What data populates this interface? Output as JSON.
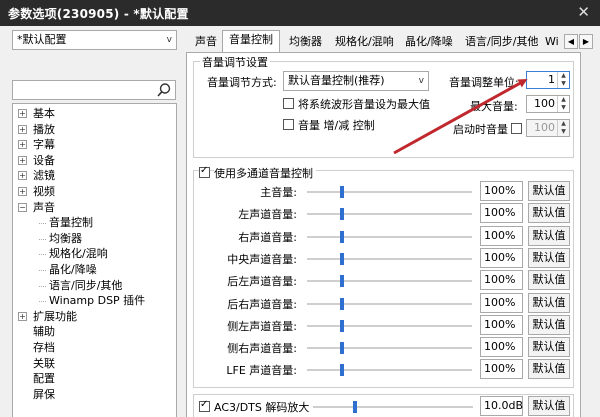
{
  "window": {
    "title": "参数选项(230905) - *默认配置",
    "close_glyph": "✕"
  },
  "profile_select": {
    "value": "*默认配置"
  },
  "search": {
    "value": ""
  },
  "tree": [
    {
      "label": "基本",
      "level": 0,
      "expand": "+"
    },
    {
      "label": "播放",
      "level": 0,
      "expand": "+"
    },
    {
      "label": "字幕",
      "level": 0,
      "expand": "+"
    },
    {
      "label": "设备",
      "level": 0,
      "expand": "+"
    },
    {
      "label": "滤镜",
      "level": 0,
      "expand": "+"
    },
    {
      "label": "视频",
      "level": 0,
      "expand": "+"
    },
    {
      "label": "声音",
      "level": 0,
      "expand": "−"
    },
    {
      "label": "音量控制",
      "level": 1
    },
    {
      "label": "均衡器",
      "level": 1
    },
    {
      "label": "规格化/混响",
      "level": 1
    },
    {
      "label": "晶化/降噪",
      "level": 1
    },
    {
      "label": "语言/同步/其他",
      "level": 1
    },
    {
      "label": "Winamp DSP 插件",
      "level": 1
    },
    {
      "label": "扩展功能",
      "level": 0,
      "expand": "+"
    },
    {
      "label": "辅助",
      "level": 0
    },
    {
      "label": "存档",
      "level": 0
    },
    {
      "label": "关联",
      "level": 0
    },
    {
      "label": "配置",
      "level": 0
    },
    {
      "label": "屏保",
      "level": 0
    }
  ],
  "tabs": [
    "声音",
    "音量控制",
    "均衡器",
    "规格化/混响",
    "晶化/降噪",
    "语言/同步/其他",
    "Wi"
  ],
  "tab_nav": {
    "prev": "◀",
    "next": "▶"
  },
  "volume_settings": {
    "group_title": "音量调节设置",
    "method_label": "音量调节方式:",
    "method_value": "默认音量控制(推荐)",
    "cb_max_wave": "将系统波形音量设为最大值",
    "cb_inc_dec": "音量 增/减 控制",
    "unit_label": "音量调整单位:",
    "unit_value": "1",
    "max_label": "最大音量:",
    "max_value": "100",
    "startup_label": "启动时音量",
    "startup_value": "100"
  },
  "multichannel": {
    "checkbox_label": "使用多通道音量控制",
    "default_label": "默认值",
    "channels": [
      {
        "label": "主音量:",
        "value": "100%",
        "level": 0.2
      },
      {
        "label": "左声道音量:",
        "value": "100%",
        "level": 0.2
      },
      {
        "label": "右声道音量:",
        "value": "100%",
        "level": 0.2
      },
      {
        "label": "中央声道音量:",
        "value": "100%",
        "level": 0.2
      },
      {
        "label": "后左声道音量:",
        "value": "100%",
        "level": 0.2
      },
      {
        "label": "后右声道音量:",
        "value": "100%",
        "level": 0.2
      },
      {
        "label": "侧左声道音量:",
        "value": "100%",
        "level": 0.2
      },
      {
        "label": "侧右声道音量:",
        "value": "100%",
        "level": 0.2
      },
      {
        "label": "LFE 声道音量:",
        "value": "100%",
        "level": 0.2
      }
    ]
  },
  "ac3": {
    "checkbox_label": "AC3/DTS 解码放大",
    "value": "10.0dB",
    "level": 0.25,
    "default_label": "默认值"
  },
  "colors": {
    "accent": "#2f6fd0",
    "arrow": "#c0282d",
    "titlebar": "#2b2b2b"
  }
}
